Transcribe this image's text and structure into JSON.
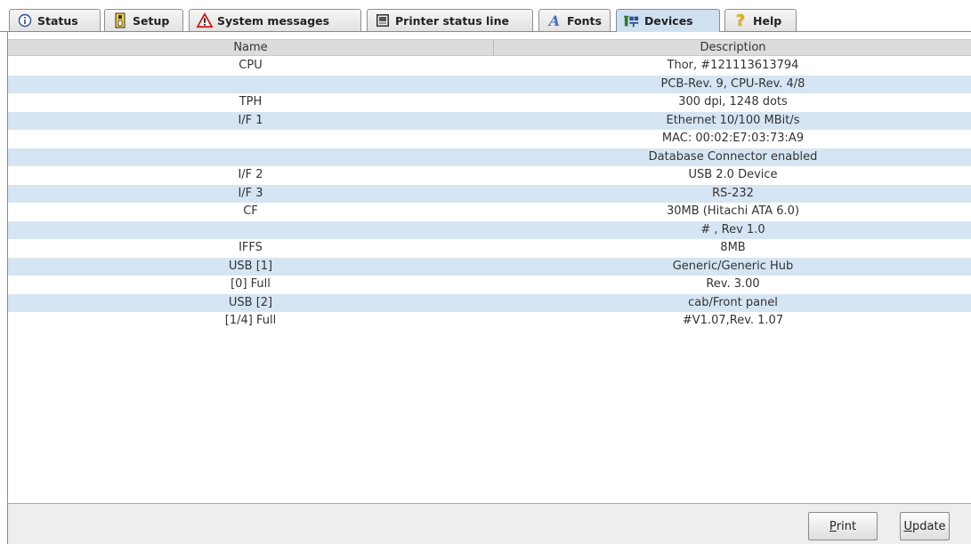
{
  "tabs": [
    {
      "label": "Status",
      "icon": "info-icon"
    },
    {
      "label": "Setup",
      "icon": "setup-icon"
    },
    {
      "label": "System messages",
      "icon": "warning-icon"
    },
    {
      "label": "Printer status line",
      "icon": "printer-status-icon"
    },
    {
      "label": "Fonts",
      "icon": "fonts-icon"
    },
    {
      "label": "Devices",
      "icon": "devices-icon",
      "active": true
    },
    {
      "label": "Help",
      "icon": "help-icon"
    }
  ],
  "table": {
    "headers": {
      "name": "Name",
      "description": "Description"
    },
    "rows": [
      {
        "name": "CPU",
        "description": "Thor, #121113613794"
      },
      {
        "name": "",
        "description": "PCB-Rev. 9, CPU-Rev. 4/8"
      },
      {
        "name": "TPH",
        "description": "300 dpi, 1248 dots"
      },
      {
        "name": "I/F 1",
        "description": "Ethernet 10/100 MBit/s"
      },
      {
        "name": "",
        "description": "MAC: 00:02:E7:03:73:A9"
      },
      {
        "name": "",
        "description": "Database Connector enabled"
      },
      {
        "name": "I/F 2",
        "description": "USB 2.0 Device"
      },
      {
        "name": "I/F 3",
        "description": "RS-232"
      },
      {
        "name": "CF",
        "description": "30MB (Hitachi ATA  6.0)"
      },
      {
        "name": "",
        "description": "# , Rev 1.0"
      },
      {
        "name": "IFFS",
        "description": "8MB"
      },
      {
        "name": "USB [1]",
        "description": "Generic/Generic Hub"
      },
      {
        "name": "[0] Full",
        "description": "Rev. 3.00"
      },
      {
        "name": "USB [2]",
        "description": "cab/Front panel"
      },
      {
        "name": "[1/4] Full",
        "description": "#V1.07,Rev. 1.07"
      }
    ]
  },
  "buttons": {
    "print": {
      "mnemonic": "P",
      "rest": "rint"
    },
    "update": {
      "mnemonic": "U",
      "rest": "pdate"
    }
  },
  "colors": {
    "row_stripe": "#d6e5f3",
    "active_tab": "#cfe0f1",
    "header_bg": "#dcdcdc"
  }
}
